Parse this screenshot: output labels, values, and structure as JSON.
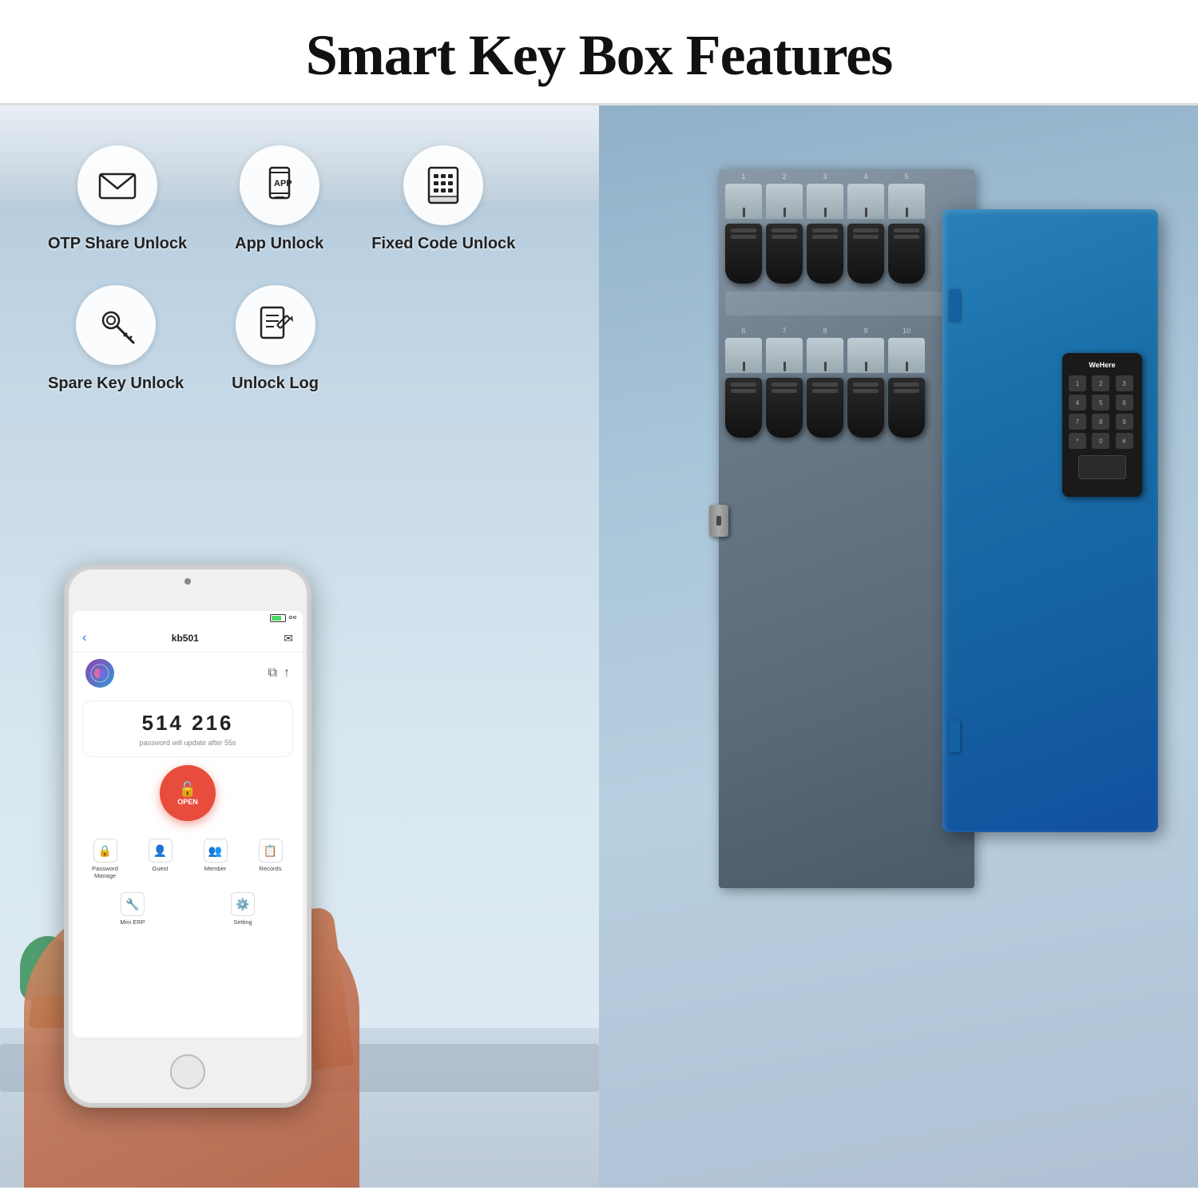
{
  "page": {
    "title": "Smart Key Box Features",
    "background_color": "#ffffff"
  },
  "features": {
    "row1": [
      {
        "id": "otp-share-unlock",
        "label": "OTP Share Unlock",
        "icon": "envelope"
      },
      {
        "id": "app-unlock",
        "label": "App Unlock",
        "icon": "app"
      },
      {
        "id": "fixed-code-unlock",
        "label": "Fixed Code Unlock",
        "icon": "keypad"
      }
    ],
    "row2": [
      {
        "id": "spare-key-unlock",
        "label": "Spare Key Unlock",
        "icon": "key"
      },
      {
        "id": "unlock-log",
        "label": "Unlock Log",
        "icon": "document"
      }
    ]
  },
  "phone": {
    "header_title": "kb501",
    "back_label": "‹",
    "otp_code": "514 216",
    "otp_timer": "password will update after 55s",
    "open_button_label": "OPEN",
    "menu_items": [
      {
        "label": "Password\nManage",
        "icon": "🔒"
      },
      {
        "label": "Guest",
        "icon": "👤"
      },
      {
        "label": "Member",
        "icon": "👥"
      },
      {
        "label": "Records",
        "icon": "📋"
      },
      {
        "label": "Mini ERP",
        "icon": "⚙️"
      },
      {
        "label": "Setting",
        "icon": "⚙️"
      }
    ]
  },
  "product": {
    "brand": "WeHere",
    "keypad_numbers": [
      "1",
      "2",
      "3",
      "4",
      "5",
      "6",
      "7",
      "8",
      "9",
      "*",
      "0",
      "#"
    ]
  },
  "colors": {
    "accent_blue": "#2980b9",
    "open_red": "#e74c3c",
    "text_dark": "#111111",
    "phone_screen_bg": "#ffffff"
  }
}
